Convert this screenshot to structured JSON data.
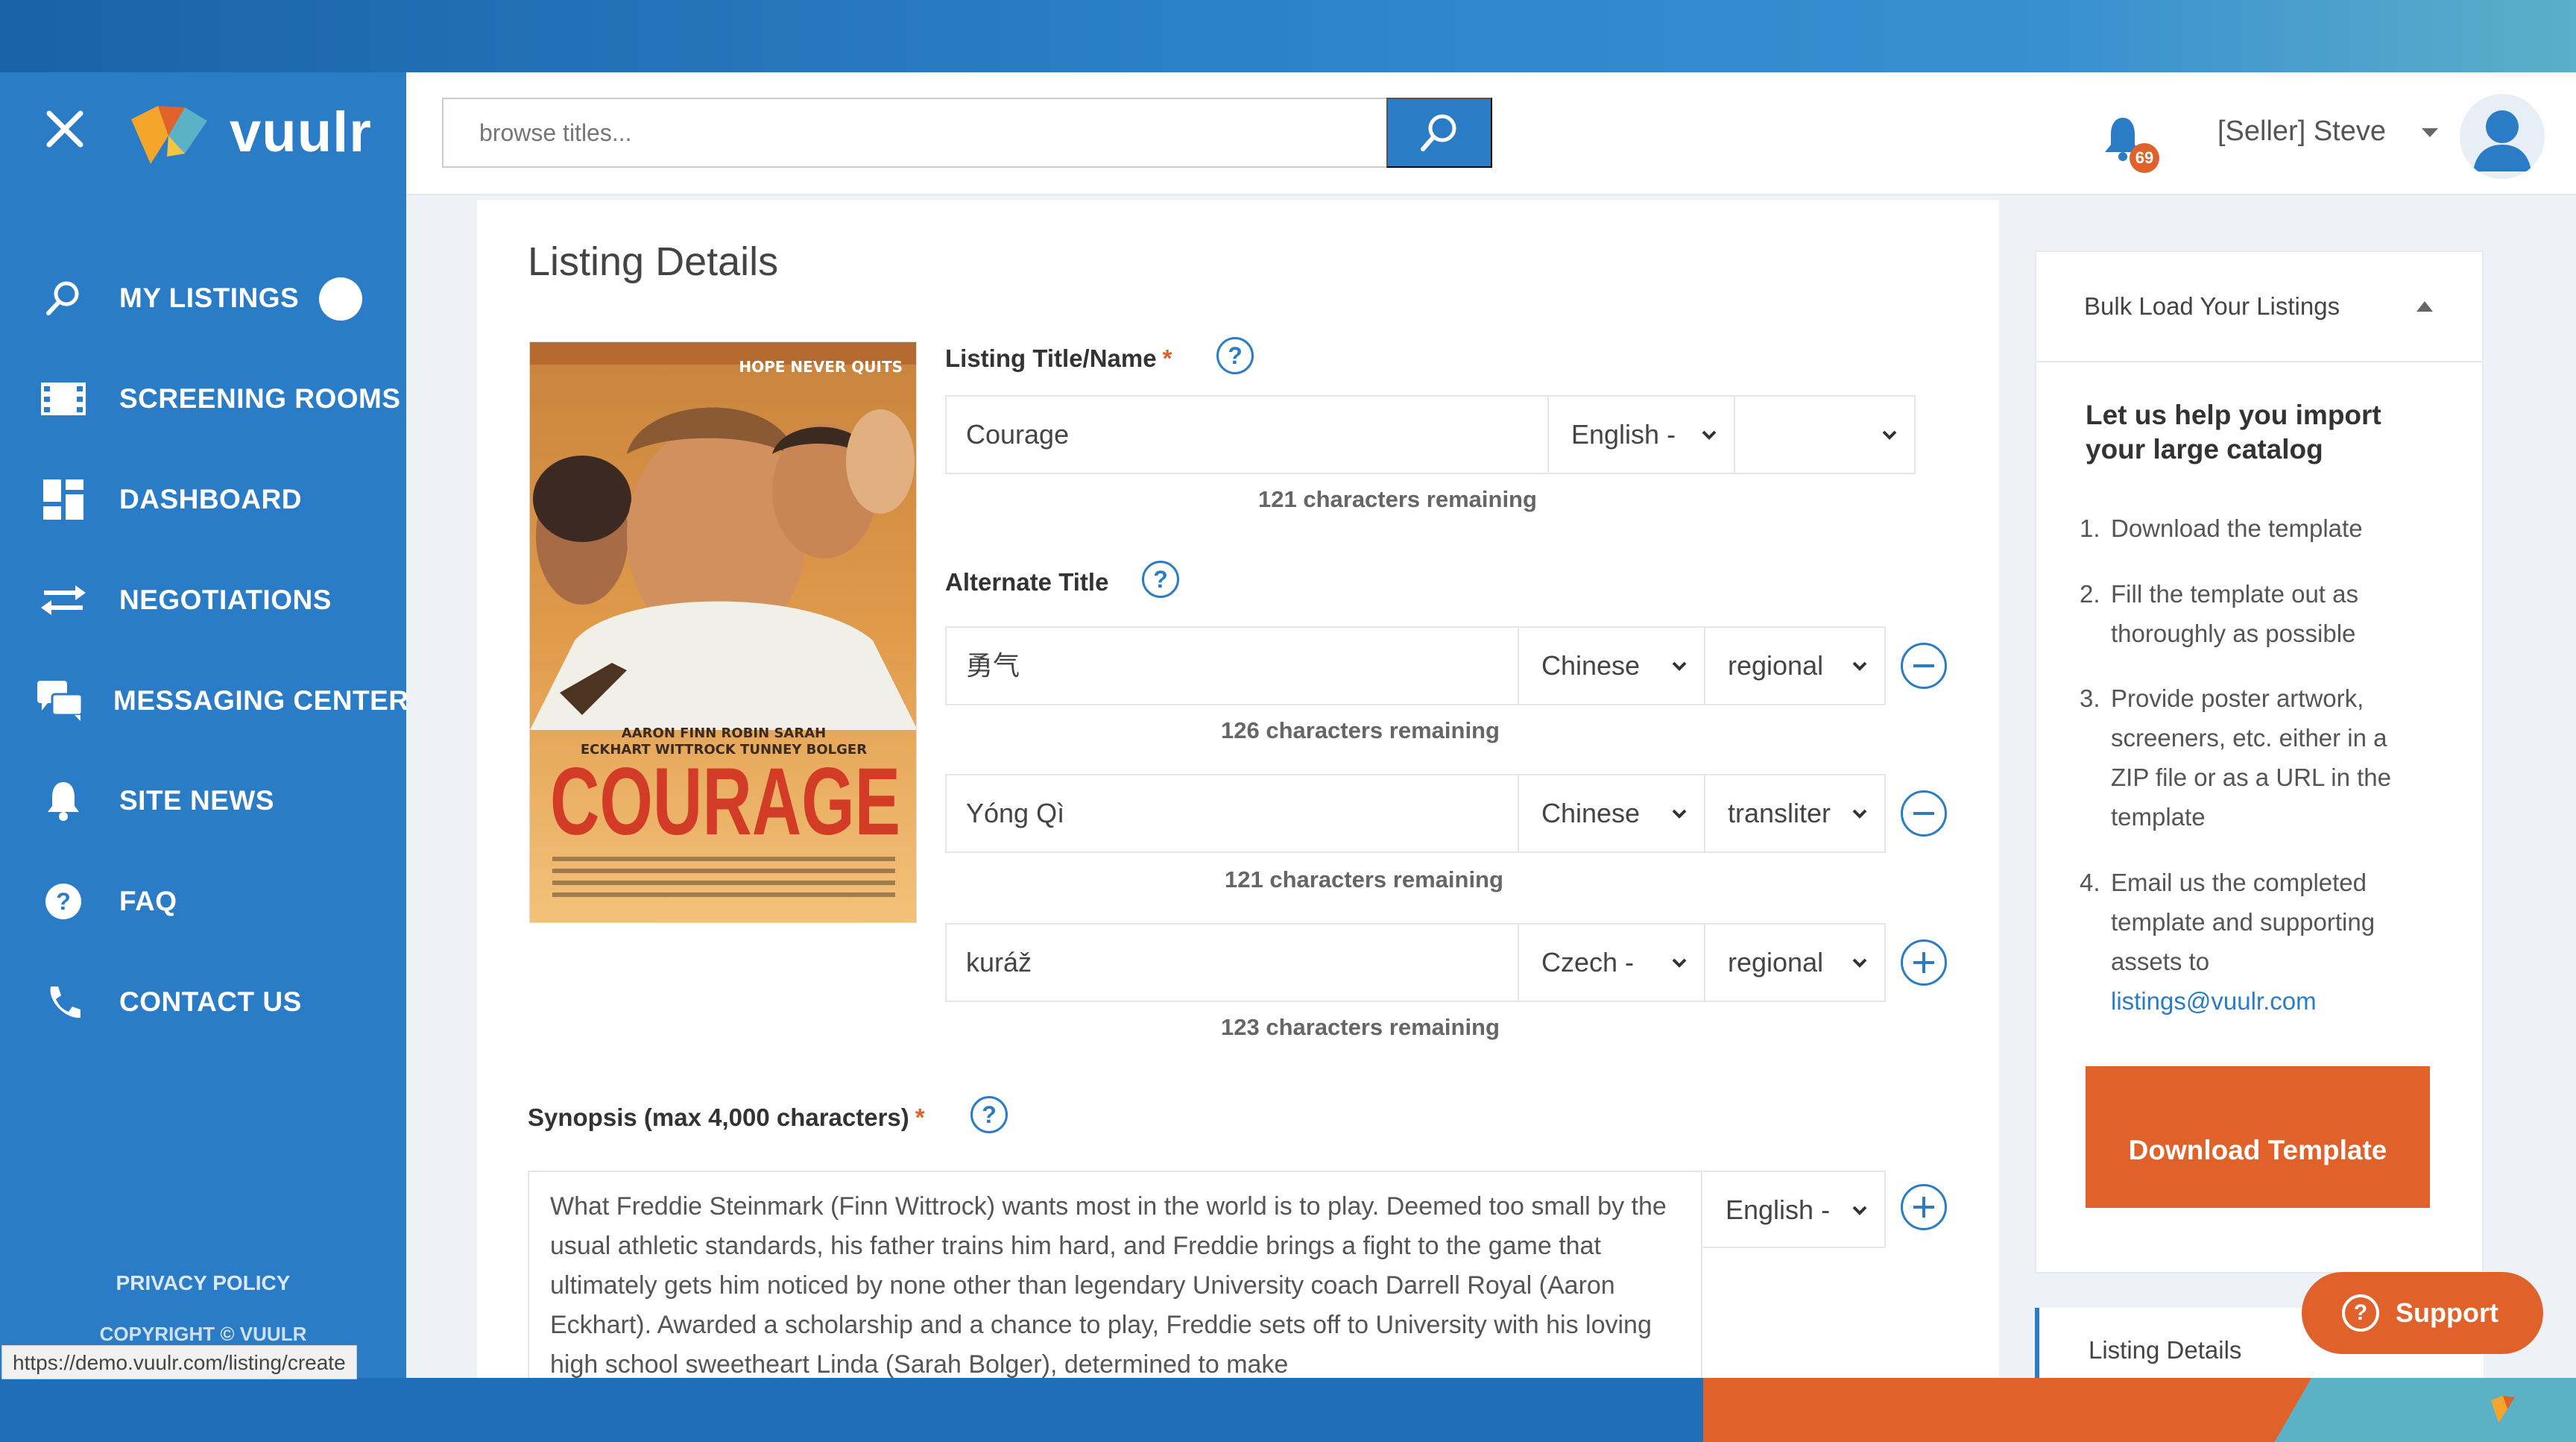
{
  "app": {
    "brand": "vuulr"
  },
  "search": {
    "placeholder": "browse titles..."
  },
  "header": {
    "notification_count": "69",
    "user": "[Seller] Steve"
  },
  "nav": {
    "items": [
      {
        "label": "MY LISTINGS",
        "icon": "search-icon"
      },
      {
        "label": "SCREENING ROOMS",
        "icon": "film-icon"
      },
      {
        "label": "DASHBOARD",
        "icon": "dashboard-icon"
      },
      {
        "label": "NEGOTIATIONS",
        "icon": "arrows-icon"
      },
      {
        "label": "MESSAGING CENTER",
        "icon": "chat-icon"
      },
      {
        "label": "SITE NEWS",
        "icon": "bell-icon"
      },
      {
        "label": "FAQ",
        "icon": "help-icon"
      },
      {
        "label": "CONTACT US",
        "icon": "phone-icon"
      }
    ],
    "privacy": "PRIVACY POLICY",
    "copyright": "COPYRIGHT © VUULR"
  },
  "status_url": "https://demo.vuulr.com/listing/create",
  "page": {
    "title": "Listing Details",
    "poster": {
      "tagline": "HOPE NEVER QUITS",
      "title": "COURAGE"
    },
    "listing_title": {
      "label": "Listing Title/Name",
      "value": "Courage",
      "language": "English -",
      "variant": "",
      "remaining": "121 characters remaining"
    },
    "alternate_title": {
      "label": "Alternate Title",
      "rows": [
        {
          "value": "勇气",
          "language": "Chinese",
          "type": "regional",
          "remaining": "126 characters remaining",
          "action": "remove"
        },
        {
          "value": "Yóng Qì",
          "language": "Chinese",
          "type": "transliter",
          "remaining": "121 characters remaining",
          "action": "remove"
        },
        {
          "value": "kuráž",
          "language": "Czech -",
          "type": "regional",
          "remaining": "123 characters remaining",
          "action": "add"
        }
      ]
    },
    "synopsis": {
      "label": "Synopsis (max 4,000 characters)",
      "language": "English -",
      "text": "What Freddie Steinmark (Finn Wittrock) wants most in the world is to play. Deemed too small by the usual athletic standards, his father trains him hard, and Freddie brings a fight to the game that ultimately gets him noticed by none other than legendary University coach Darrell Royal (Aaron Eckhart). Awarded a scholarship and a chance to play, Freddie sets off to University with his loving high school sweetheart Linda (Sarah Bolger), determined to make"
    }
  },
  "side_panel": {
    "bulk_title": "Bulk Load Your Listings",
    "heading": "Let us help you import your large catalog",
    "steps": [
      {
        "num": "1.",
        "text": "Download the template"
      },
      {
        "num": "2.",
        "text": "Fill the template out as thoroughly as possible"
      },
      {
        "num": "3.",
        "text": "Provide poster artwork, screeners, etc. either in a ZIP file or as a URL in the template"
      },
      {
        "num": "4.",
        "text": "Email us the completed template and supporting assets to"
      }
    ],
    "email": "listings@vuulr.com",
    "download_button": "Download Template",
    "nav_label": "Listing Details"
  },
  "support": {
    "label": "Support"
  },
  "colors": {
    "primary": "#2a7cc7",
    "accent": "#e0622a",
    "background": "#eef2f6"
  }
}
